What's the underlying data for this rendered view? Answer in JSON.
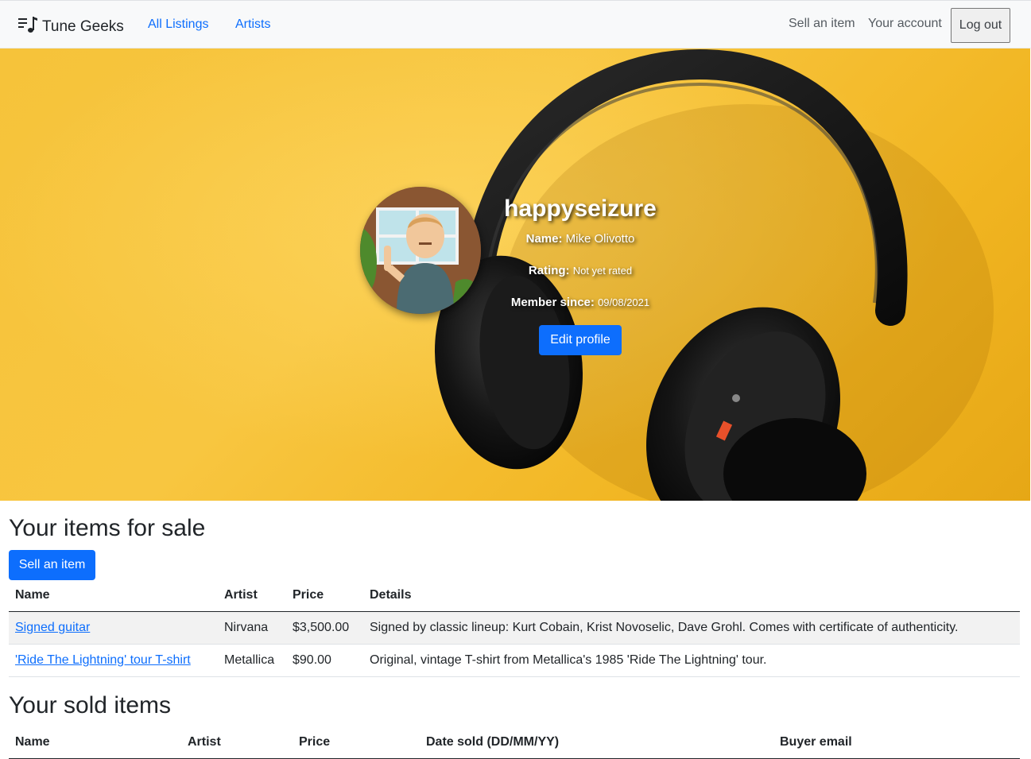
{
  "navbar": {
    "brand": "Tune Geeks",
    "links": [
      "All Listings",
      "Artists"
    ],
    "right": {
      "sell": "Sell an item",
      "account": "Your account",
      "logout": "Log out"
    }
  },
  "profile": {
    "username": "happyseizure",
    "name_label": "Name:",
    "name_value": "Mike Olivotto",
    "rating_label": "Rating:",
    "rating_value": "Not yet rated",
    "member_label": "Member since:",
    "member_value": "09/08/2021",
    "edit_button": "Edit profile"
  },
  "for_sale": {
    "title": "Your items for sale",
    "sell_button": "Sell an item",
    "columns": [
      "Name",
      "Artist",
      "Price",
      "Details"
    ],
    "rows": [
      {
        "name": "Signed guitar",
        "artist": "Nirvana",
        "price": "$3,500.00",
        "details": "Signed by classic lineup: Kurt Cobain, Krist Novoselic, Dave Grohl. Comes with certificate of authenticity."
      },
      {
        "name": "'Ride The Lightning' tour T-shirt",
        "artist": "Metallica",
        "price": "$90.00",
        "details": "Original, vintage T-shirt from Metallica's 1985 'Ride The Lightning' tour."
      }
    ]
  },
  "sold": {
    "title": "Your sold items",
    "columns": [
      "Name",
      "Artist",
      "Price",
      "Date sold (DD/MM/YY)",
      "Buyer email"
    ]
  },
  "colors": {
    "primary": "#0d6efd",
    "navbar_bg": "#f8f9fa",
    "hero_yellow": "#f6c33a"
  }
}
